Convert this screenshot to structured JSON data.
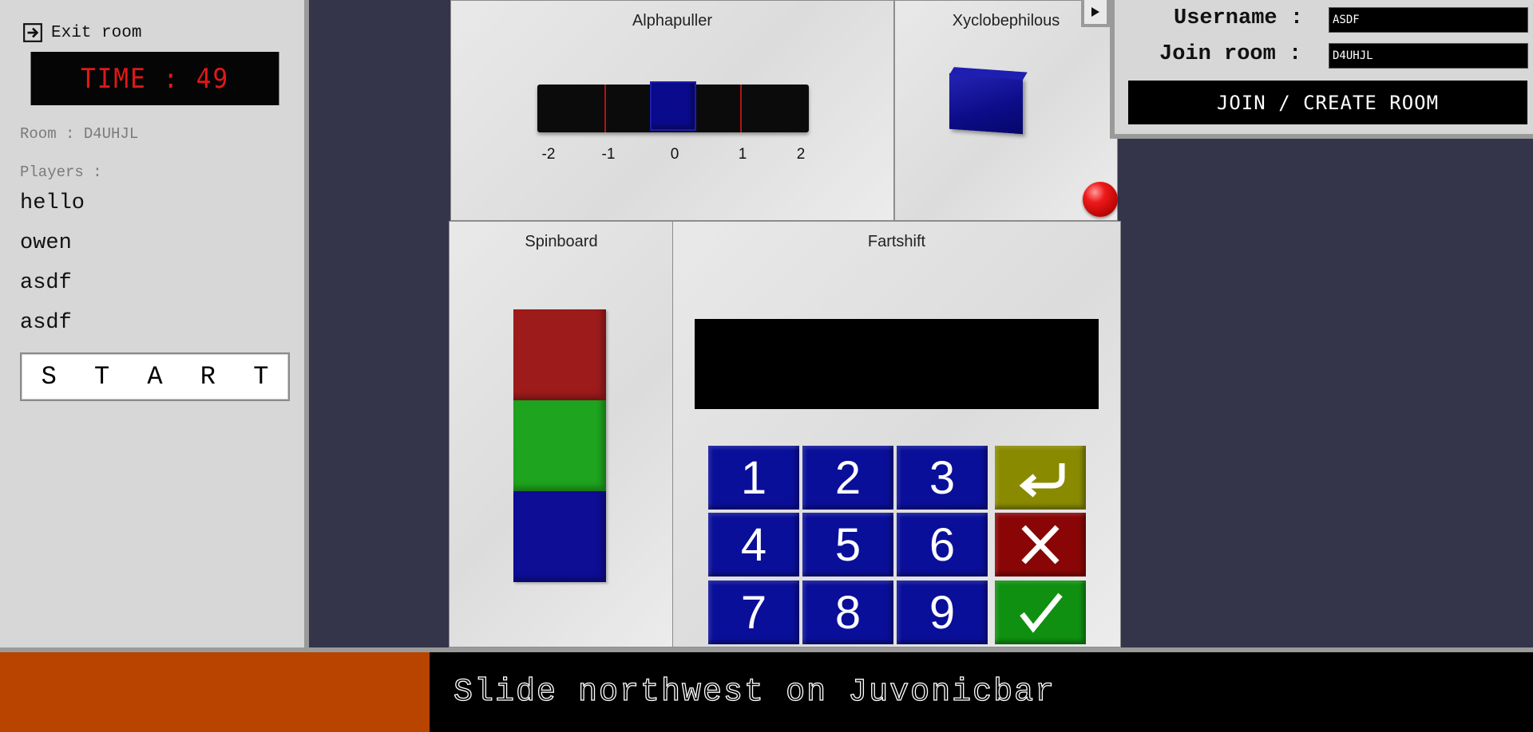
{
  "sidebar": {
    "exit_label": "Exit room",
    "timer_text": "TIME : 49",
    "room_text": "Room : D4UHJL",
    "players_label": "Players :",
    "players": [
      "hello",
      "owen",
      "asdf",
      "asdf"
    ],
    "start_label": "S T A R T"
  },
  "modules": {
    "alphapuller": {
      "title": "Alphapuller",
      "ticks": [
        "-2",
        "-1",
        "0",
        "1",
        "2"
      ],
      "value": 0,
      "range": [
        -2,
        2
      ],
      "knob_color": "#0a0a8c",
      "marker_color": "#b21414"
    },
    "xyclobephilous": {
      "title": "Xyclobephilous",
      "block_color": "#0c0c88",
      "ball_color": "#ee1a1a"
    },
    "spinboard": {
      "title": "Spinboard",
      "blocks": [
        "#9e1b1b",
        "#1ea41e",
        "#0d0d96"
      ]
    },
    "fartshift": {
      "title": "Fartshift",
      "screen_text": "",
      "keys": [
        "1",
        "2",
        "3",
        "4",
        "5",
        "6",
        "7",
        "8",
        "9"
      ],
      "enter_icon": "return-arrow-icon",
      "clear_icon": "x-icon",
      "ok_icon": "check-icon",
      "colors": {
        "digit": "#0a0f9a",
        "enter": "#8a8a00",
        "clear": "#8a0606",
        "ok": "#109010"
      }
    }
  },
  "login": {
    "username_label": "Username :",
    "username_value": "ASDF",
    "room_label": "Join room :",
    "room_value": "D4UHJL",
    "join_button": "JOIN / CREATE ROOM"
  },
  "instruction": {
    "text": "Slide northwest on Juvonicbar",
    "progress": 1.0,
    "progress_color": "#b84400"
  }
}
